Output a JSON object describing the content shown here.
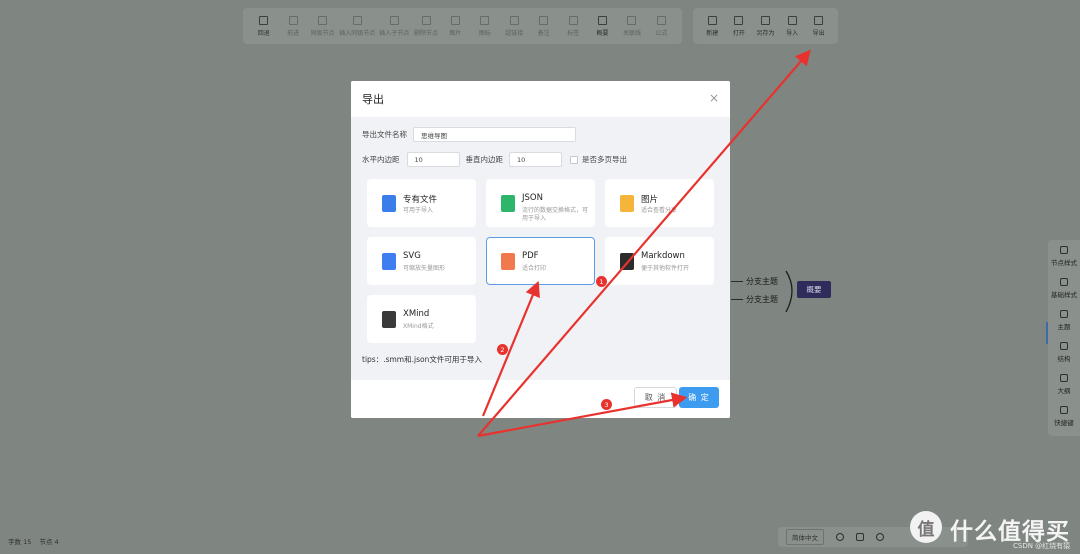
{
  "toolbar_left": {
    "items": [
      {
        "label": "回退",
        "icon": "undo-icon",
        "enabled": true
      },
      {
        "label": "前进",
        "icon": "redo-icon",
        "enabled": false
      },
      {
        "label": "同级节点",
        "icon": "sibling-node-icon",
        "enabled": false
      },
      {
        "label": "插入同级节点",
        "icon": "insert-sibling-icon",
        "enabled": false
      },
      {
        "label": "插入子节点",
        "icon": "insert-child-icon",
        "enabled": false
      },
      {
        "label": "删除节点",
        "icon": "delete-node-icon",
        "enabled": false
      },
      {
        "label": "图片",
        "icon": "image-icon",
        "enabled": false
      },
      {
        "label": "图标",
        "icon": "emoji-icon",
        "enabled": false
      },
      {
        "label": "超链接",
        "icon": "link-icon",
        "enabled": false
      },
      {
        "label": "备注",
        "icon": "note-icon",
        "enabled": false
      },
      {
        "label": "标签",
        "icon": "tag-icon",
        "enabled": false
      },
      {
        "label": "概要",
        "icon": "summary-icon",
        "enabled": true
      },
      {
        "label": "关联线",
        "icon": "association-line-icon",
        "enabled": false
      },
      {
        "label": "公式",
        "icon": "formula-icon",
        "enabled": false
      }
    ]
  },
  "toolbar_right": {
    "items": [
      {
        "label": "新建",
        "icon": "new-file-icon"
      },
      {
        "label": "打开",
        "icon": "open-folder-icon"
      },
      {
        "label": "另存为",
        "icon": "save-as-icon"
      },
      {
        "label": "导入",
        "icon": "import-icon"
      },
      {
        "label": "导出",
        "icon": "export-icon"
      }
    ]
  },
  "mindmap": {
    "branches": [
      "分支主题",
      "分支主题"
    ],
    "summary": "概要"
  },
  "side_panel": {
    "items": [
      {
        "label": "节点样式",
        "icon": "node-style-icon"
      },
      {
        "label": "基础样式",
        "icon": "base-style-icon"
      },
      {
        "label": "主题",
        "icon": "theme-shirt-icon"
      },
      {
        "label": "结构",
        "icon": "structure-icon"
      },
      {
        "label": "大纲",
        "icon": "outline-icon"
      },
      {
        "label": "快捷键",
        "icon": "keyboard-icon"
      }
    ]
  },
  "statusbar": {
    "words_label": "字数 15",
    "nodes_label": "节点 4"
  },
  "bottombar": {
    "language": "简体中文"
  },
  "watermark": {
    "logo_text": "值",
    "text": "什么值得买",
    "csdn": "CSDN @红烧有猿"
  },
  "dialog": {
    "title": "导出",
    "filename_label": "导出文件名称",
    "filename_value": "思维导图",
    "padding_h_label": "水平内边距",
    "padding_h_value": "10",
    "padding_v_label": "垂直内边距",
    "padding_v_value": "10",
    "multipage_label": "是否多页导出",
    "multipage_checked": false,
    "formats": [
      {
        "name": "专有文件",
        "desc": "可用于导入",
        "icon": "smm-file-icon",
        "color": "#3b7de9",
        "selected": false
      },
      {
        "name": "JSON",
        "desc": "流行的数据交换格式，可用于导入",
        "icon": "json-file-icon",
        "color": "#2db56b",
        "selected": false
      },
      {
        "name": "图片",
        "desc": "适合查看分享",
        "icon": "png-image-icon",
        "color": "#f5b53b",
        "selected": false
      },
      {
        "name": "SVG",
        "desc": "可缩放矢量图形",
        "icon": "svg-file-icon",
        "color": "#3f7ef0",
        "selected": false
      },
      {
        "name": "PDF",
        "desc": "适合打印",
        "icon": "pdf-file-icon",
        "color": "#f07a4e",
        "selected": true
      },
      {
        "name": "Markdown",
        "desc": "便于其他软件打开",
        "icon": "markdown-icon",
        "color": "#2b2b2b",
        "selected": false
      },
      {
        "name": "XMind",
        "desc": "XMind格式",
        "icon": "xmind-file-icon",
        "color": "#3a3a3a",
        "selected": false
      }
    ],
    "tips": "tips：.smm和.json文件可用于导入",
    "cancel_label": "取 消",
    "confirm_label": "确 定"
  },
  "annotations": {
    "color": "#e8322e",
    "badges": [
      "1",
      "2",
      "3"
    ]
  }
}
